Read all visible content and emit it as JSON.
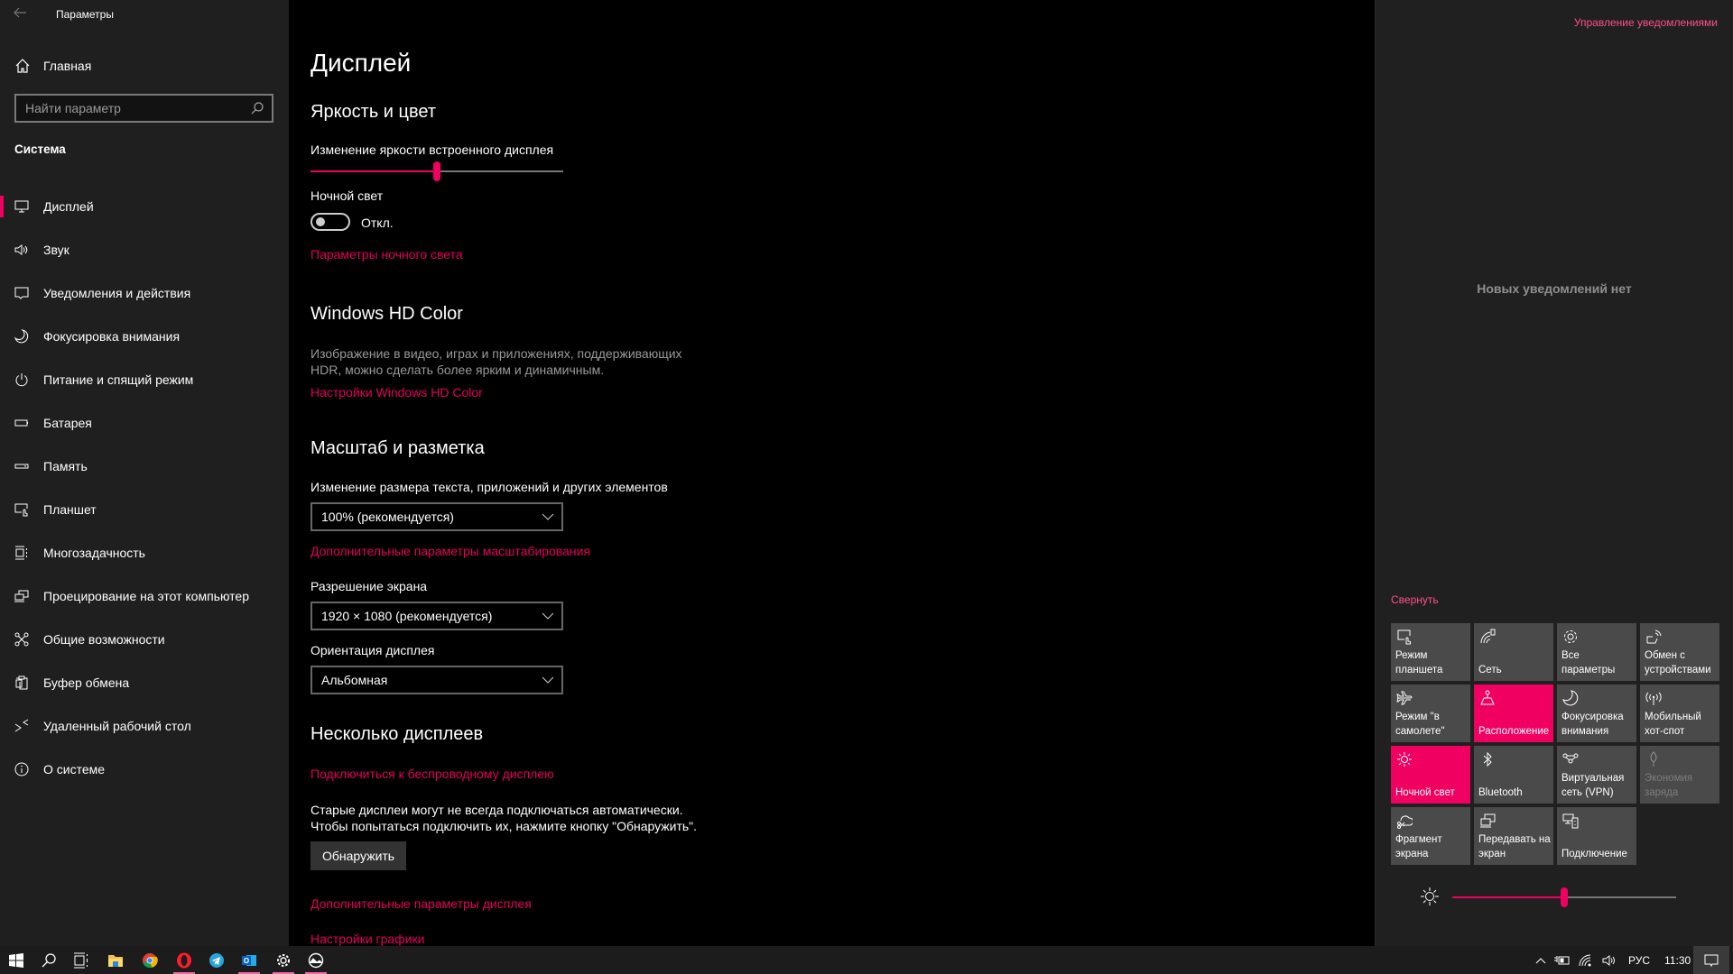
{
  "window": {
    "app_title": "Параметры",
    "back_icon": "back-arrow-icon"
  },
  "sidebar": {
    "home_label": "Главная",
    "search_placeholder": "Найти параметр",
    "section_label": "Система",
    "items": [
      {
        "label": "Дисплей",
        "icon": "monitor-icon",
        "active": true
      },
      {
        "label": "Звук",
        "icon": "speaker-icon",
        "active": false
      },
      {
        "label": "Уведомления и действия",
        "icon": "notification-icon",
        "active": false
      },
      {
        "label": "Фокусировка внимания",
        "icon": "moon-icon",
        "active": false
      },
      {
        "label": "Питание и спящий режим",
        "icon": "power-icon",
        "active": false
      },
      {
        "label": "Батарея",
        "icon": "battery-icon",
        "active": false
      },
      {
        "label": "Память",
        "icon": "storage-icon",
        "active": false
      },
      {
        "label": "Планшет",
        "icon": "tablet-icon",
        "active": false
      },
      {
        "label": "Многозадачность",
        "icon": "multitasking-icon",
        "active": false
      },
      {
        "label": "Проецирование на этот компьютер",
        "icon": "project-icon",
        "active": false
      },
      {
        "label": "Общие возможности",
        "icon": "shared-experiences-icon",
        "active": false
      },
      {
        "label": "Буфер обмена",
        "icon": "clipboard-icon",
        "active": false
      },
      {
        "label": "Удаленный рабочий стол",
        "icon": "remote-desktop-icon",
        "active": false
      },
      {
        "label": "О системе",
        "icon": "info-icon",
        "active": false
      }
    ]
  },
  "main": {
    "page_title": "Дисплей",
    "brightness_section": {
      "heading": "Яркость и цвет",
      "slider_label": "Изменение яркости встроенного дисплея",
      "brightness_percent": 50,
      "night_light_label": "Ночной свет",
      "night_light_state": "Откл.",
      "night_light_on": false,
      "night_light_link": "Параметры ночного света"
    },
    "hd_color_section": {
      "heading": "Windows HD Color",
      "description_line1": "Изображение в видео, играх и приложениях, поддерживающих",
      "description_line2": "HDR, можно сделать более ярким и динамичным.",
      "link": "Настройки Windows HD Color"
    },
    "scale_section": {
      "heading": "Масштаб и разметка",
      "scale_label": "Изменение размера текста, приложений и других элементов",
      "scale_value": "100% (рекомендуется)",
      "scale_link": "Дополнительные параметры масштабирования",
      "resolution_label": "Разрешение экрана",
      "resolution_value": "1920 × 1080 (рекомендуется)",
      "orientation_label": "Ориентация дисплея",
      "orientation_value": "Альбомная"
    },
    "multi_display_section": {
      "heading": "Несколько дисплеев",
      "wireless_link": "Подключиться к беспроводному дисплею",
      "note_line1": "Старые дисплеи могут не всегда подключаться автоматически.",
      "note_line2": "Чтобы попытаться подключить их, нажмите кнопку \"Обнаружить\".",
      "detect_button": "Обнаружить",
      "advanced_link": "Дополнительные параметры дисплея",
      "graphics_link": "Настройки графики"
    }
  },
  "action_center": {
    "manage_link": "Управление уведомлениями",
    "empty_text": "Новых уведомлений нет",
    "collapse_link": "Свернуть",
    "tiles": [
      {
        "label": "Режим планшета",
        "icon": "tablet-mode-icon",
        "state": "off"
      },
      {
        "label": "Сеть",
        "icon": "network-icon",
        "state": "off"
      },
      {
        "label": "Все параметры",
        "icon": "settings-gear-icon",
        "state": "off"
      },
      {
        "label": "Обмен с устройствами",
        "icon": "nearby-share-icon",
        "state": "off"
      },
      {
        "label": "Режим \"в самолете\"",
        "icon": "airplane-icon",
        "state": "off"
      },
      {
        "label": "Расположение",
        "icon": "location-icon",
        "state": "on"
      },
      {
        "label": "Фокусировка внимания",
        "icon": "moon-icon",
        "state": "off"
      },
      {
        "label": "Мобильный хот-спот",
        "icon": "hotspot-icon",
        "state": "off"
      },
      {
        "label": "Ночной свет",
        "icon": "night-light-icon",
        "state": "on"
      },
      {
        "label": "Bluetooth",
        "icon": "bluetooth-icon",
        "state": "off"
      },
      {
        "label": "Виртуальная сеть (VPN)",
        "icon": "vpn-icon",
        "state": "off"
      },
      {
        "label": "Экономия заряда",
        "icon": "battery-saver-icon",
        "state": "disabled"
      },
      {
        "label": "Фрагмент экрана",
        "icon": "screen-snip-icon",
        "state": "off"
      },
      {
        "label": "Передавать на экран",
        "icon": "project-icon",
        "state": "off"
      },
      {
        "label": "Подключение",
        "icon": "connect-icon",
        "state": "off"
      }
    ],
    "brightness_percent": 50
  },
  "taskbar": {
    "apps": [
      {
        "name": "start",
        "icon": "windows-logo-icon",
        "running": false
      },
      {
        "name": "search",
        "icon": "search-icon",
        "running": false
      },
      {
        "name": "task-view",
        "icon": "task-view-icon",
        "running": false
      },
      {
        "name": "file-explorer",
        "icon": "folder-icon",
        "running": false
      },
      {
        "name": "chrome",
        "icon": "chrome-icon",
        "running": false
      },
      {
        "name": "opera",
        "icon": "opera-icon",
        "running": true
      },
      {
        "name": "telegram",
        "icon": "telegram-icon",
        "running": false
      },
      {
        "name": "outlook",
        "icon": "outlook-icon",
        "running": true
      },
      {
        "name": "settings",
        "icon": "settings-gear-icon",
        "running": true
      },
      {
        "name": "photos",
        "icon": "photos-icon",
        "running": true
      }
    ],
    "tray": {
      "language": "РУС",
      "time": "11:30"
    }
  },
  "colors": {
    "accent": "#f00060",
    "link": "#e3005c",
    "action_center_link": "#ff4f8b",
    "sidebar_bg": "#1f1f1f",
    "main_bg": "#000000",
    "tile_bg": "#4a4a4a"
  }
}
